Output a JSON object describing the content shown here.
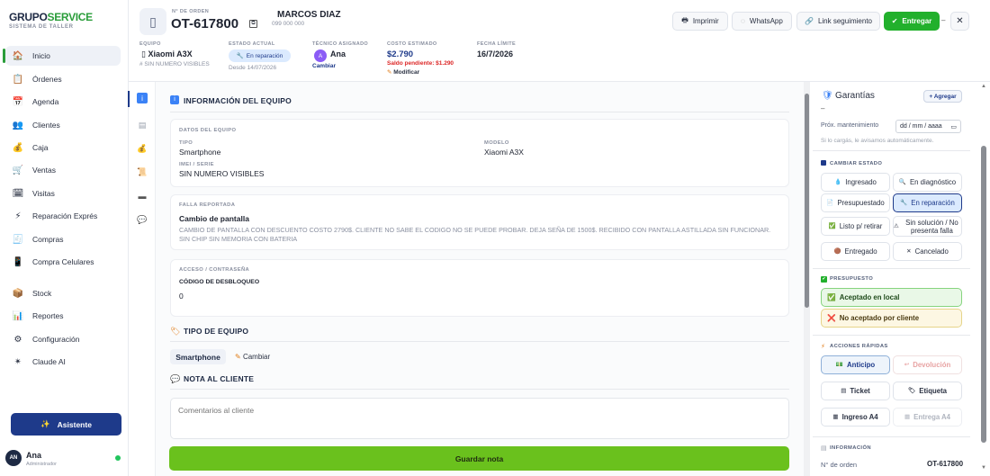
{
  "brand": {
    "part1": "GRUPO",
    "part2": "SERVICE",
    "subtitle": "SISTEMA DE TALLER"
  },
  "sidebar": {
    "items": [
      {
        "label": "Inicio",
        "icon": "home-icon",
        "glyph": "🏠"
      },
      {
        "label": "Órdenes",
        "icon": "orders-icon",
        "glyph": "📋"
      },
      {
        "label": "Agenda",
        "icon": "agenda-icon",
        "glyph": "📅"
      },
      {
        "label": "Clientes",
        "icon": "clients-icon",
        "glyph": "👥"
      },
      {
        "label": "Caja",
        "icon": "cash-icon",
        "glyph": "💰"
      },
      {
        "label": "Ventas",
        "icon": "cart-icon",
        "glyph": "🛒"
      },
      {
        "label": "Visitas",
        "icon": "calendar-icon",
        "glyph": "🗓"
      },
      {
        "label": "Reparación Exprés",
        "icon": "bolt-icon",
        "glyph": "⚡"
      },
      {
        "label": "Compras",
        "icon": "purchases-icon",
        "glyph": "🧾"
      },
      {
        "label": "Compra Celulares",
        "icon": "phone-purchase-icon",
        "glyph": "📱"
      },
      {
        "label": "Stock",
        "icon": "box-icon",
        "glyph": "📦"
      },
      {
        "label": "Reportes",
        "icon": "chart-icon",
        "glyph": "📊"
      },
      {
        "label": "Configuración",
        "icon": "gear-icon",
        "glyph": "⚙"
      },
      {
        "label": "Claude AI",
        "icon": "sparkle-icon",
        "glyph": "✴"
      }
    ],
    "assistant_label": "Asistente",
    "user": {
      "initials": "AN",
      "name": "Ana",
      "role": "Administrador"
    }
  },
  "header": {
    "order_caption": "N° DE ORDEN",
    "order_number": "OT-617800",
    "customer_name": "MARCOS DIAZ",
    "customer_phone": "099 000 000",
    "buttons": {
      "print": "Imprimir",
      "whatsapp": "WhatsApp",
      "tracking": "Link seguimiento",
      "deliver": "Entregar"
    },
    "more": "–",
    "close": "✕",
    "equipo_caption": "EQUIPO",
    "equipo": "Xiaomi A3X",
    "equipo_serial": "# SIN NUMERO VISIBLES",
    "status_caption": "ESTADO ACTUAL",
    "status": "En reparación",
    "status_since": "Desde 14/07/2026",
    "tech_caption": "TÉCNICO ASIGNADO",
    "tech_initial": "A",
    "tech_name": "Ana",
    "tech_change": "Cambiar",
    "cost_caption": "COSTO ESTIMADO",
    "cost": "$2.790",
    "cost_pending": "Saldo pendiente: $1.290",
    "cost_modify": "Modificar",
    "deadline_caption": "FECHA LÍMITE",
    "deadline": "16/7/2026"
  },
  "main": {
    "info_title": "INFORMACIÓN DEL EQUIPO",
    "datos_caption": "DATOS DEL EQUIPO",
    "tipo_caption": "TIPO",
    "tipo": "Smartphone",
    "modelo_caption": "MODELO",
    "modelo": "Xiaomi A3X",
    "imei_caption": "IMEI / SERIE",
    "imei": "SIN NUMERO VISIBLES",
    "falla_caption": "FALLA REPORTADA",
    "falla_title": "Cambio de pantalla",
    "falla_desc": "CAMBIO DE PANTALLA CON DESCUENTO COSTO 2790$. CLIENTE NO SABE EL CODIGO NO SE PUEDE PROBAR. DEJA SEÑA DE 1500$. RECIBIDO CON PANTALLA ASTILLADA SIN FUNCIONAR. SIN CHIP SIN MEMORIA CON BATERIA",
    "acceso_caption": "ACCESO / CONTRASEÑA",
    "codigo_caption": "CÓDIGO DE DESBLOQUEO",
    "codigo": "0",
    "tipo_equipo_title": "TIPO DE EQUIPO",
    "tipo_equipo_value": "Smartphone",
    "tipo_equipo_change": "Cambiar",
    "nota_title": "NOTA AL CLIENTE",
    "nota_placeholder": "Comentarios al cliente",
    "save_note": "Guardar nota"
  },
  "right": {
    "garantias_title": "Garantías",
    "add_label": "+ Agregar",
    "dash": "–",
    "maintenance_label": "Próx. mantenimiento",
    "date_placeholder": "dd / mm / aaaa",
    "maintenance_hint": "Si lo cargás, le avisamos automáticamente.",
    "cambiar_estado_caption": "CAMBIAR ESTADO",
    "states": [
      "Ingresado",
      "En diagnóstico",
      "Presupuestado",
      "En reparación",
      "Listo p/ retirar",
      "Sin solución / No presenta falla",
      "Entregado",
      "Cancelado"
    ],
    "presupuesto_caption": "PRESUPUESTO",
    "accepted": "Aceptado en local",
    "not_accepted": "No aceptado por cliente",
    "acciones_caption": "ACCIONES RÁPIDAS",
    "actions": [
      "Anticipo",
      "Devolución",
      "Ticket",
      "Etiqueta",
      "Ingreso A4",
      "Entrega A4"
    ],
    "info_caption": "INFORMACIÓN",
    "order_label": "N° de orden",
    "order_value": "OT-617800"
  },
  "colors": {
    "accent_green": "#22b02c",
    "brand_blue": "#1e3a8a",
    "pending_red": "#dc2626",
    "status_blue": "#dbeafe"
  }
}
